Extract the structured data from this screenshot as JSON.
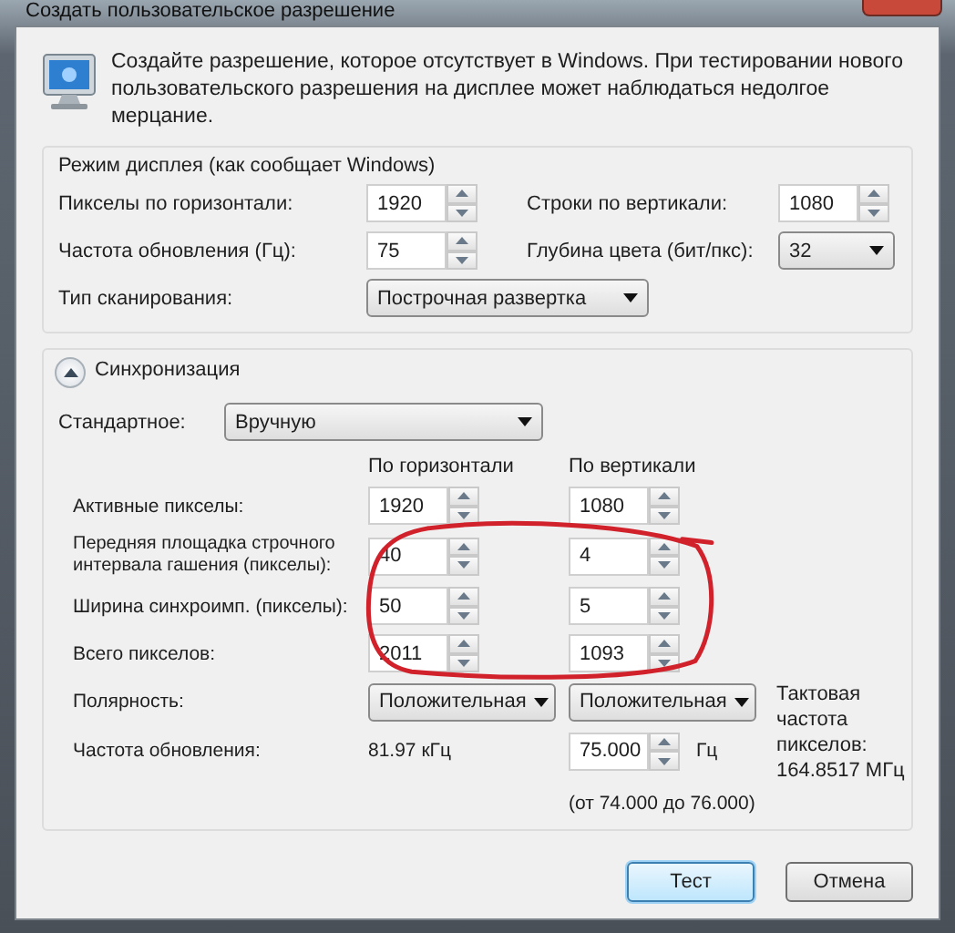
{
  "window": {
    "title": "Создать пользовательское разрешение"
  },
  "intro": "Создайте разрешение, которое отсутствует в Windows. При тестировании нового пользовательского разрешения на дисплее может наблюдаться недолгое мерцание.",
  "display_mode": {
    "title": "Режим дисплея (как сообщает Windows)",
    "fields": [
      {
        "kind": "spin",
        "label": "Пикселы по горизонтали:",
        "value": "1920"
      },
      {
        "kind": "spin",
        "label": "Строки по вертикали:",
        "value": "1080"
      },
      {
        "kind": "spin",
        "label": "Частота обновления (Гц):",
        "value": "75"
      },
      {
        "kind": "dropdown",
        "label": "Глубина цвета (бит/пкс):",
        "value": "32"
      },
      {
        "kind": "dropdown",
        "label": "Тип сканирования:",
        "value": "Построчная развертка"
      }
    ]
  },
  "timing": {
    "title": "Синхронизация",
    "expanded": true,
    "standard": {
      "label": "Стандартное:",
      "value": "Вручную"
    },
    "columns": [
      "По горизонтали",
      "По вертикали"
    ],
    "rows": [
      {
        "kind": "spin",
        "label": "Активные пикселы:",
        "horizontal": "1920",
        "vertical": "1080"
      },
      {
        "kind": "spin",
        "label": "Передняя площадка строчного интервала гашения (пикселы):",
        "horizontal": "40",
        "vertical": "4"
      },
      {
        "kind": "spin",
        "label": "Ширина синхроимп. (пикселы):",
        "horizontal": "50",
        "vertical": "5"
      },
      {
        "kind": "spin",
        "label": "Всего пикселов:",
        "horizontal": "2011",
        "vertical": "1093"
      },
      {
        "kind": "dropdown",
        "label": "Полярность:",
        "horizontal": "Положительная",
        "vertical": "Положительная"
      }
    ],
    "refresh": {
      "label": "Частота обновления:",
      "line_rate": "81.97 кГц",
      "value": "75.000",
      "unit": "Гц",
      "range": "(от 74.000 до 76.000)"
    },
    "pixel_clock": {
      "label": "Тактовая частота пикселов:",
      "value": "164.8517 МГц"
    }
  },
  "buttons": [
    {
      "label": "Тест",
      "default": true
    },
    {
      "label": "Отмена",
      "default": false
    }
  ],
  "annotation": {
    "kind": "ellipse"
  }
}
